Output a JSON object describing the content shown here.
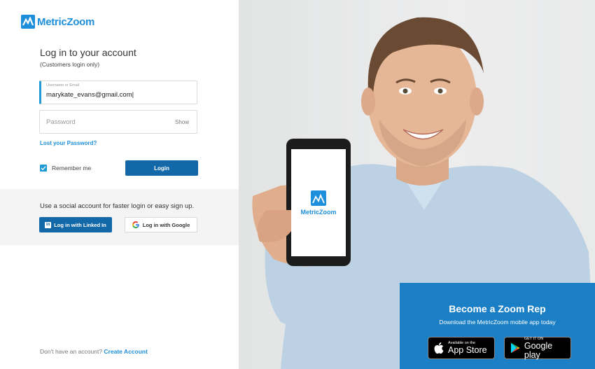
{
  "brand": {
    "name": "MetricZoom",
    "color": "#1e8fdb"
  },
  "login": {
    "title": "Log in to your account",
    "subtitle": "(Customers login only)",
    "email": {
      "label": "Username or Email",
      "value": "marykate_evans@gmail.com|"
    },
    "password": {
      "placeholder": "Password",
      "show_label": "Show"
    },
    "lost_password": "Lost your Password?",
    "remember_label": "Remember me",
    "remember_checked": true,
    "login_button": "Login"
  },
  "social": {
    "text": "Use a social account for faster login or easy sign up.",
    "linkedin_button": "Log in with Linked In",
    "google_button": "Log in with Google"
  },
  "footer": {
    "prompt": "Don't have an account?",
    "link": "Create Account"
  },
  "promo": {
    "title": "Become a Zoom Rep",
    "subtitle": "Download the MetricZoom mobile app today",
    "apple": {
      "small": "Available on the",
      "big": "App Store"
    },
    "google": {
      "small": "GET IT ON",
      "big": "Google play"
    }
  },
  "phone_screen_logo": "MetricZoom"
}
